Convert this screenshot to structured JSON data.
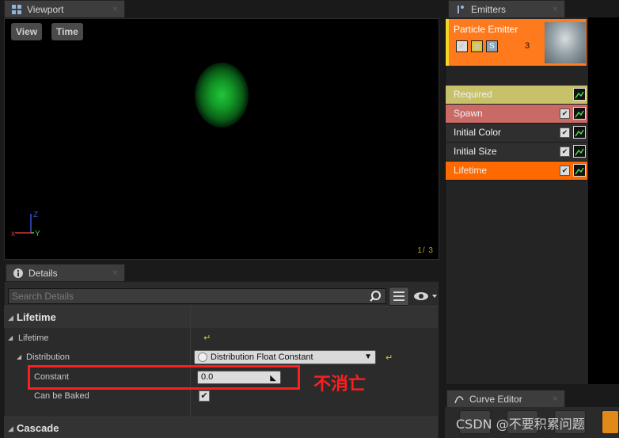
{
  "viewport": {
    "tab_label": "Viewport",
    "close": "×",
    "view_button": "View",
    "time_button": "Time",
    "axis_z": "Z",
    "axis_y": "Y",
    "axis_x": "x",
    "frame_counter": "1/  3"
  },
  "emitters": {
    "tab_label": "Emitters",
    "close": "×",
    "emitter_name": "Particle Emitter",
    "emitter_count": "3",
    "solo_label": "S",
    "modules": [
      {
        "label": "Required",
        "color": "#c7c26a"
      },
      {
        "label": "Spawn",
        "color": "#c96a66"
      },
      {
        "label": "Initial Color",
        "color": "#2f2f2f"
      },
      {
        "label": "Initial Size",
        "color": "#2f2f2f"
      },
      {
        "label": "Lifetime",
        "color": "#ff6a00"
      }
    ]
  },
  "details": {
    "tab_label": "Details",
    "close": "×",
    "search_placeholder": "Search Details",
    "category_lifetime": "Lifetime",
    "prop_lifetime": "Lifetime",
    "prop_distribution": "Distribution",
    "distribution_value": "Distribution Float Constant",
    "prop_constant": "Constant",
    "constant_value": "0.0",
    "prop_can_be_baked": "Can be Baked",
    "can_be_baked_checked": true,
    "category_cascade": "Cascade"
  },
  "annotation": {
    "text": "不消亡",
    "color": "#ff1e1e"
  },
  "curve_editor": {
    "tab_label": "Curve Editor",
    "close": "×"
  },
  "watermark": "CSDN @不要积累问题"
}
